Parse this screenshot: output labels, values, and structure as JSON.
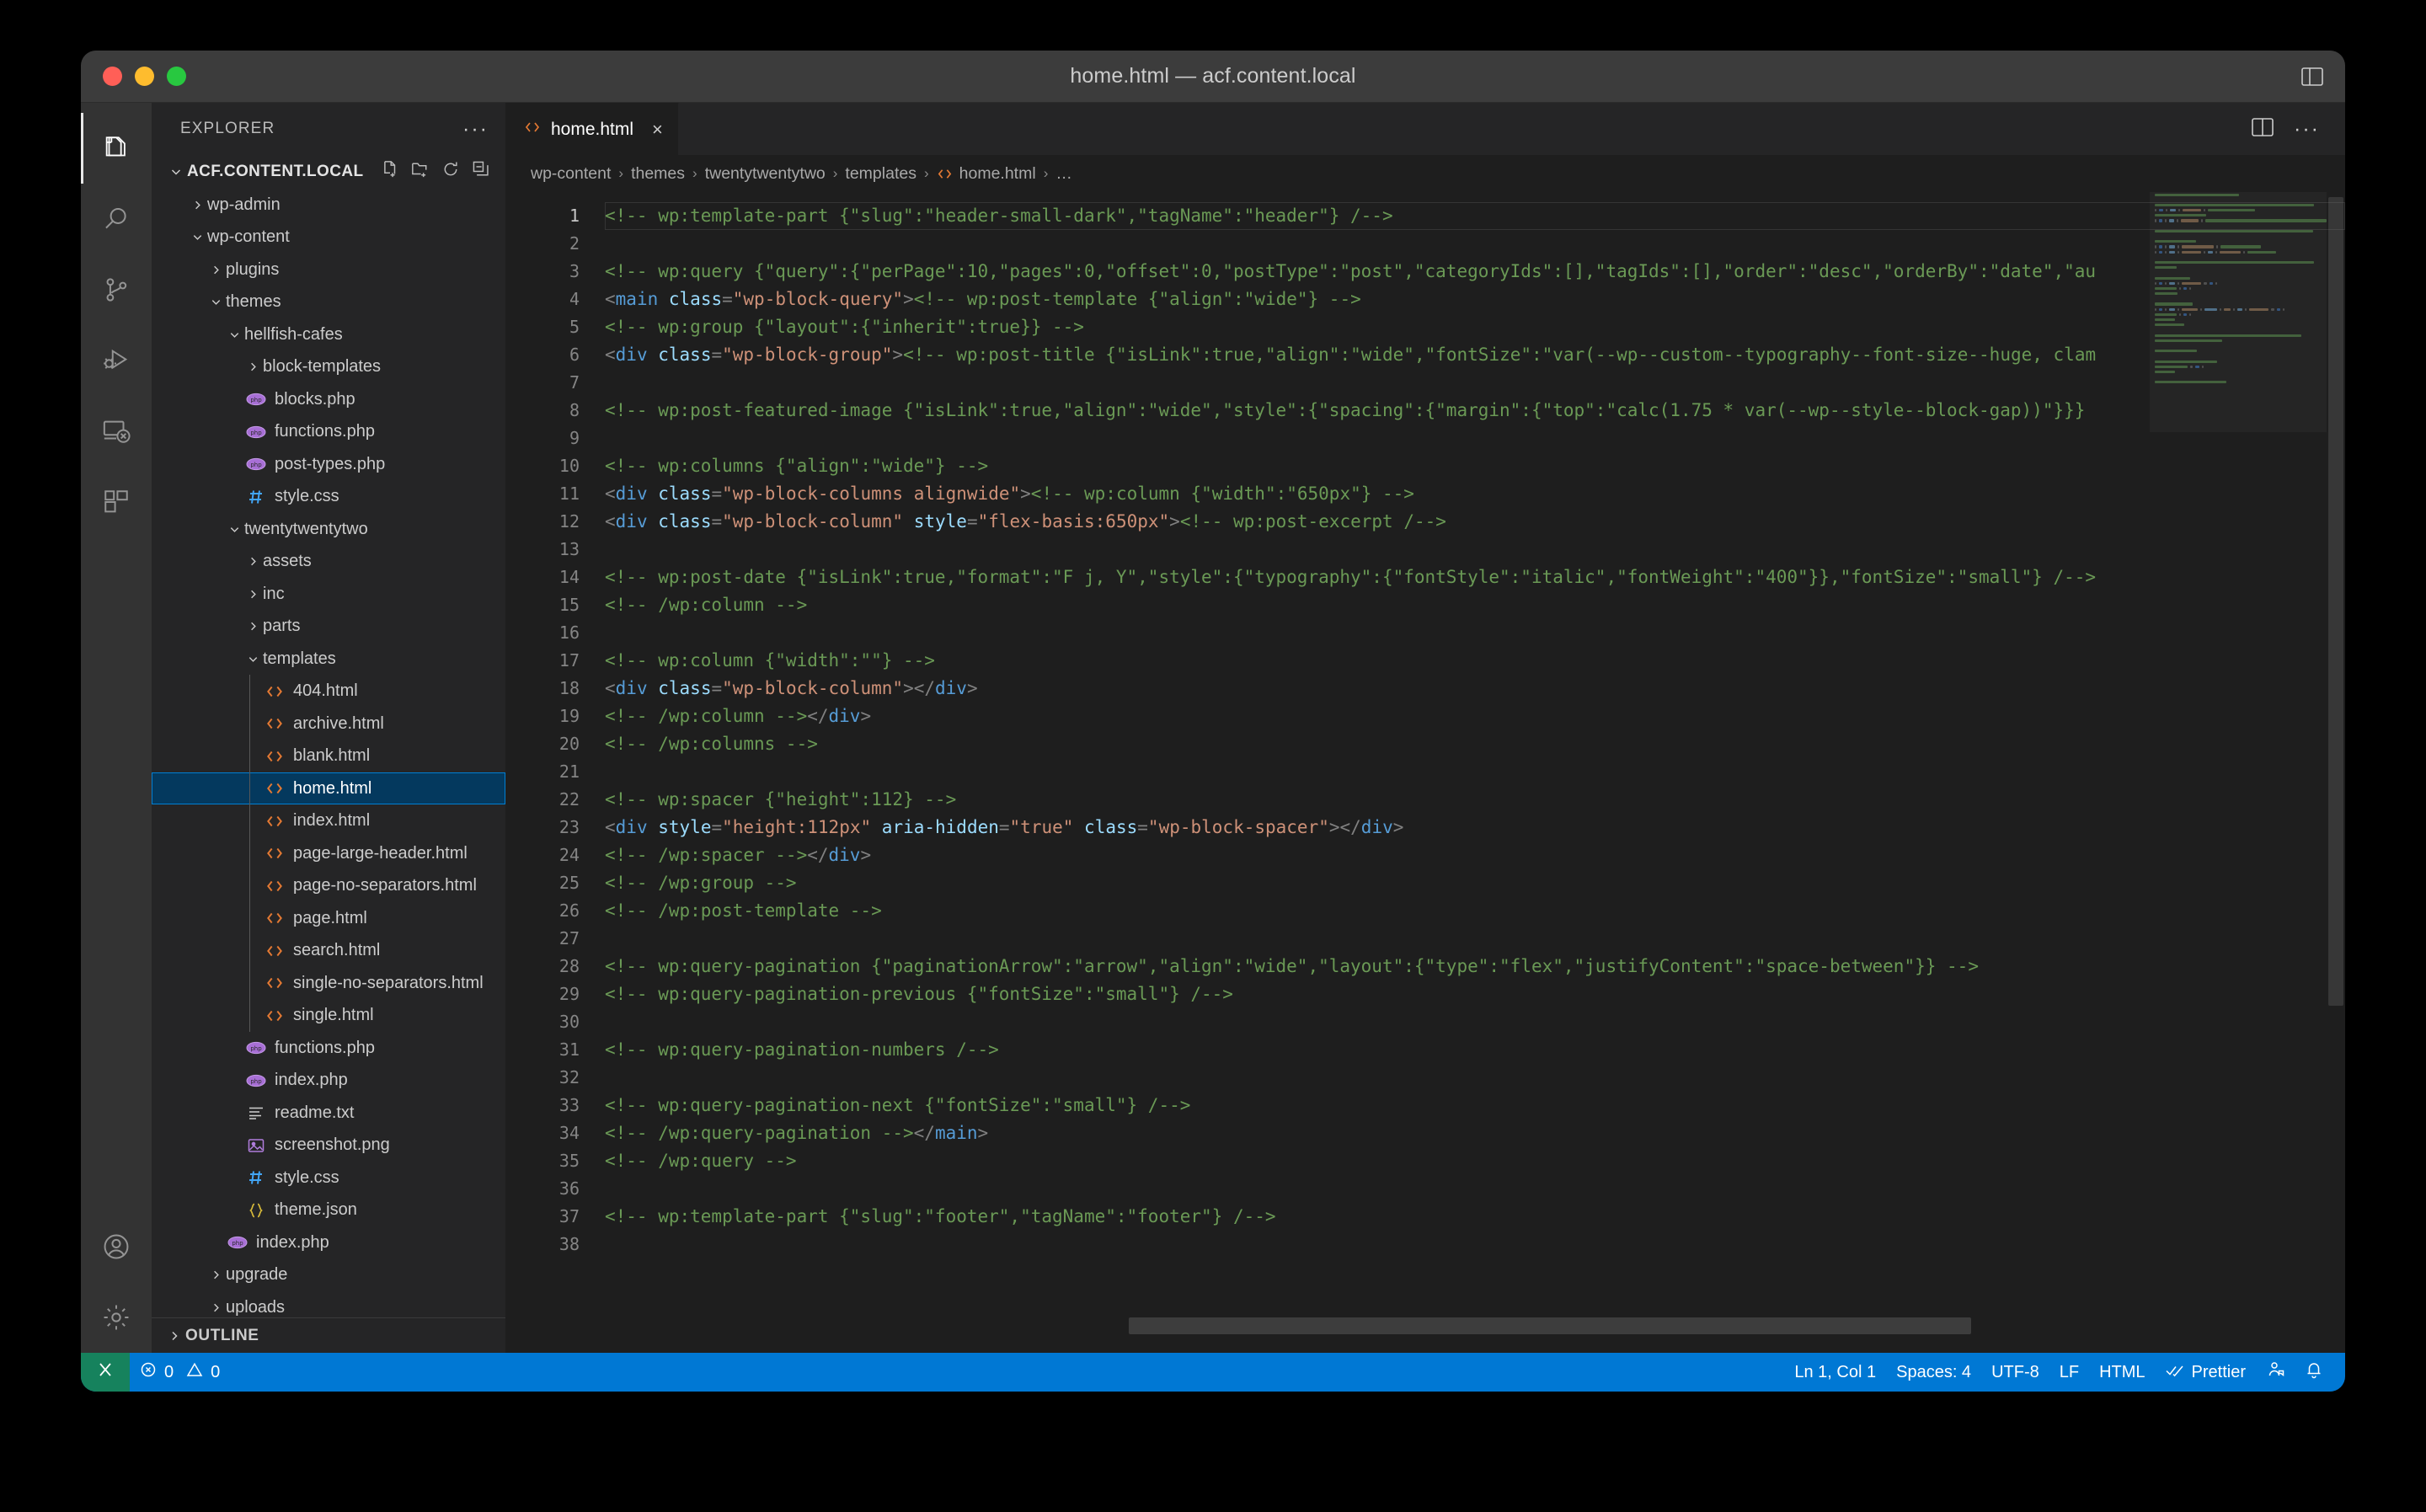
{
  "window": {
    "title": "home.html — acf.content.local",
    "traffic_lights": [
      "close-red",
      "minimize-yellow",
      "maximize-green"
    ],
    "layout_icon": "customize-layout-icon"
  },
  "activitybar": {
    "items": [
      {
        "name": "explorer",
        "icon": "files-icon",
        "active": true
      },
      {
        "name": "search",
        "icon": "search-icon",
        "active": false
      },
      {
        "name": "source-control",
        "icon": "source-control-icon",
        "active": false
      },
      {
        "name": "run-and-debug",
        "icon": "run-debug-icon",
        "active": false
      },
      {
        "name": "remote-explorer",
        "icon": "remote-explorer-icon",
        "active": false
      },
      {
        "name": "extensions",
        "icon": "extensions-icon",
        "active": false
      }
    ],
    "bottom_items": [
      {
        "name": "accounts",
        "icon": "account-icon"
      },
      {
        "name": "manage",
        "icon": "gear-icon"
      }
    ]
  },
  "sidebar": {
    "header_title": "EXPLORER",
    "more_actions_label": "···",
    "root_label": "ACF.CONTENT.LOCAL",
    "root_actions": [
      "new-file-icon",
      "new-folder-icon",
      "refresh-icon",
      "collapse-all-icon"
    ],
    "outline_label": "OUTLINE",
    "tree": [
      {
        "label": "wp-admin",
        "depth": 1,
        "type": "folder",
        "expanded": false
      },
      {
        "label": "wp-content",
        "depth": 1,
        "type": "folder",
        "expanded": true
      },
      {
        "label": "plugins",
        "depth": 2,
        "type": "folder",
        "expanded": false
      },
      {
        "label": "themes",
        "depth": 2,
        "type": "folder",
        "expanded": true
      },
      {
        "label": "hellfish-cafes",
        "depth": 3,
        "type": "folder",
        "expanded": true
      },
      {
        "label": "block-templates",
        "depth": 4,
        "type": "folder",
        "expanded": false
      },
      {
        "label": "blocks.php",
        "depth": 4,
        "type": "php"
      },
      {
        "label": "functions.php",
        "depth": 4,
        "type": "php"
      },
      {
        "label": "post-types.php",
        "depth": 4,
        "type": "php"
      },
      {
        "label": "style.css",
        "depth": 4,
        "type": "css"
      },
      {
        "label": "twentytwentytwo",
        "depth": 3,
        "type": "folder",
        "expanded": true
      },
      {
        "label": "assets",
        "depth": 4,
        "type": "folder",
        "expanded": false
      },
      {
        "label": "inc",
        "depth": 4,
        "type": "folder",
        "expanded": false
      },
      {
        "label": "parts",
        "depth": 4,
        "type": "folder",
        "expanded": false
      },
      {
        "label": "templates",
        "depth": 4,
        "type": "folder",
        "expanded": true
      },
      {
        "label": "404.html",
        "depth": 5,
        "type": "html"
      },
      {
        "label": "archive.html",
        "depth": 5,
        "type": "html"
      },
      {
        "label": "blank.html",
        "depth": 5,
        "type": "html"
      },
      {
        "label": "home.html",
        "depth": 5,
        "type": "html",
        "selected": true
      },
      {
        "label": "index.html",
        "depth": 5,
        "type": "html"
      },
      {
        "label": "page-large-header.html",
        "depth": 5,
        "type": "html"
      },
      {
        "label": "page-no-separators.html",
        "depth": 5,
        "type": "html"
      },
      {
        "label": "page.html",
        "depth": 5,
        "type": "html"
      },
      {
        "label": "search.html",
        "depth": 5,
        "type": "html"
      },
      {
        "label": "single-no-separators.html",
        "depth": 5,
        "type": "html"
      },
      {
        "label": "single.html",
        "depth": 5,
        "type": "html"
      },
      {
        "label": "functions.php",
        "depth": 4,
        "type": "php"
      },
      {
        "label": "index.php",
        "depth": 4,
        "type": "php"
      },
      {
        "label": "readme.txt",
        "depth": 4,
        "type": "txt"
      },
      {
        "label": "screenshot.png",
        "depth": 4,
        "type": "png"
      },
      {
        "label": "style.css",
        "depth": 4,
        "type": "css"
      },
      {
        "label": "theme.json",
        "depth": 4,
        "type": "json"
      },
      {
        "label": "index.php",
        "depth": 3,
        "type": "php"
      },
      {
        "label": "upgrade",
        "depth": 2,
        "type": "folder",
        "expanded": false
      },
      {
        "label": "uploads",
        "depth": 2,
        "type": "folder",
        "expanded": false
      }
    ]
  },
  "editor": {
    "tabs": [
      {
        "label": "home.html",
        "icon": "html-file-icon",
        "close_glyph": "×",
        "active": true
      }
    ],
    "actions": [
      "split-editor-icon",
      "more-actions-icon"
    ],
    "breadcrumbs": [
      {
        "label": "wp-content",
        "icon": null
      },
      {
        "label": "themes",
        "icon": null
      },
      {
        "label": "twentytwentytwo",
        "icon": null
      },
      {
        "label": "templates",
        "icon": null
      },
      {
        "label": "home.html",
        "icon": "html-file-icon"
      },
      {
        "label": "…",
        "icon": null
      }
    ],
    "breadcrumb_separator": "›",
    "total_lines": 38,
    "current_line": 1,
    "lines": [
      {
        "n": 1,
        "tokens": [
          {
            "t": "<!-- wp:template-part {\"slug\":\"header-small-dark\",\"tagName\":\"header\"} /-->",
            "c": "cm"
          }
        ]
      },
      {
        "n": 2,
        "tokens": []
      },
      {
        "n": 3,
        "tokens": [
          {
            "t": "<!-- wp:query {\"query\":{\"perPage\":10,\"pages\":0,\"offset\":0,\"postType\":\"post\",\"categoryIds\":[],\"tagIds\":[],\"order\":\"desc\",\"orderBy\":\"date\",\"au",
            "c": "cm"
          }
        ]
      },
      {
        "n": 4,
        "tokens": [
          {
            "t": "<",
            "c": "pn"
          },
          {
            "t": "main",
            "c": "tg"
          },
          {
            "t": " ",
            "c": "pn"
          },
          {
            "t": "class",
            "c": "at"
          },
          {
            "t": "=",
            "c": "pn"
          },
          {
            "t": "\"wp-block-query\"",
            "c": "st"
          },
          {
            "t": ">",
            "c": "pn"
          },
          {
            "t": "<!-- wp:post-template {\"align\":\"wide\"} -->",
            "c": "cm"
          }
        ]
      },
      {
        "n": 5,
        "tokens": [
          {
            "t": "<!-- wp:group {\"layout\":{\"inherit\":true}} -->",
            "c": "cm"
          }
        ]
      },
      {
        "n": 6,
        "tokens": [
          {
            "t": "<",
            "c": "pn"
          },
          {
            "t": "div",
            "c": "tg"
          },
          {
            "t": " ",
            "c": "pn"
          },
          {
            "t": "class",
            "c": "at"
          },
          {
            "t": "=",
            "c": "pn"
          },
          {
            "t": "\"wp-block-group\"",
            "c": "st"
          },
          {
            "t": ">",
            "c": "pn"
          },
          {
            "t": "<!-- wp:post-title {\"isLink\":true,\"align\":\"wide\",\"fontSize\":\"var(--wp--custom--typography--font-size--huge, clam",
            "c": "cm"
          }
        ]
      },
      {
        "n": 7,
        "tokens": []
      },
      {
        "n": 8,
        "tokens": [
          {
            "t": "<!-- wp:post-featured-image {\"isLink\":true,\"align\":\"wide\",\"style\":{\"spacing\":{\"margin\":{\"top\":\"calc(1.75 * var(--wp--style--block-gap))\"}}}",
            "c": "cm"
          }
        ]
      },
      {
        "n": 9,
        "tokens": []
      },
      {
        "n": 10,
        "tokens": [
          {
            "t": "<!-- wp:columns {\"align\":\"wide\"} -->",
            "c": "cm"
          }
        ]
      },
      {
        "n": 11,
        "tokens": [
          {
            "t": "<",
            "c": "pn"
          },
          {
            "t": "div",
            "c": "tg"
          },
          {
            "t": " ",
            "c": "pn"
          },
          {
            "t": "class",
            "c": "at"
          },
          {
            "t": "=",
            "c": "pn"
          },
          {
            "t": "\"wp-block-columns alignwide\"",
            "c": "st"
          },
          {
            "t": ">",
            "c": "pn"
          },
          {
            "t": "<!-- wp:column {\"width\":\"650px\"} -->",
            "c": "cm"
          }
        ]
      },
      {
        "n": 12,
        "tokens": [
          {
            "t": "<",
            "c": "pn"
          },
          {
            "t": "div",
            "c": "tg"
          },
          {
            "t": " ",
            "c": "pn"
          },
          {
            "t": "class",
            "c": "at"
          },
          {
            "t": "=",
            "c": "pn"
          },
          {
            "t": "\"wp-block-column\"",
            "c": "st"
          },
          {
            "t": " ",
            "c": "pn"
          },
          {
            "t": "style",
            "c": "at"
          },
          {
            "t": "=",
            "c": "pn"
          },
          {
            "t": "\"flex-basis:650px\"",
            "c": "st"
          },
          {
            "t": ">",
            "c": "pn"
          },
          {
            "t": "<!-- wp:post-excerpt /-->",
            "c": "cm"
          }
        ]
      },
      {
        "n": 13,
        "tokens": []
      },
      {
        "n": 14,
        "tokens": [
          {
            "t": "<!-- wp:post-date {\"isLink\":true,\"format\":\"F j, Y\",\"style\":{\"typography\":{\"fontStyle\":\"italic\",\"fontWeight\":\"400\"}},\"fontSize\":\"small\"} /-->",
            "c": "cm"
          }
        ]
      },
      {
        "n": 15,
        "tokens": [
          {
            "t": "<!-- /wp:column -->",
            "c": "cm"
          }
        ]
      },
      {
        "n": 16,
        "tokens": []
      },
      {
        "n": 17,
        "tokens": [
          {
            "t": "<!-- wp:column {\"width\":\"\"} -->",
            "c": "cm"
          }
        ]
      },
      {
        "n": 18,
        "tokens": [
          {
            "t": "<",
            "c": "pn"
          },
          {
            "t": "div",
            "c": "tg"
          },
          {
            "t": " ",
            "c": "pn"
          },
          {
            "t": "class",
            "c": "at"
          },
          {
            "t": "=",
            "c": "pn"
          },
          {
            "t": "\"wp-block-column\"",
            "c": "st"
          },
          {
            "t": "></",
            "c": "pn"
          },
          {
            "t": "div",
            "c": "tg"
          },
          {
            "t": ">",
            "c": "pn"
          }
        ]
      },
      {
        "n": 19,
        "tokens": [
          {
            "t": "<!-- /wp:column -->",
            "c": "cm"
          },
          {
            "t": "</",
            "c": "pn"
          },
          {
            "t": "div",
            "c": "tg"
          },
          {
            "t": ">",
            "c": "pn"
          }
        ]
      },
      {
        "n": 20,
        "tokens": [
          {
            "t": "<!-- /wp:columns -->",
            "c": "cm"
          }
        ]
      },
      {
        "n": 21,
        "tokens": []
      },
      {
        "n": 22,
        "tokens": [
          {
            "t": "<!-- wp:spacer {\"height\":112} -->",
            "c": "cm"
          }
        ]
      },
      {
        "n": 23,
        "tokens": [
          {
            "t": "<",
            "c": "pn"
          },
          {
            "t": "div",
            "c": "tg"
          },
          {
            "t": " ",
            "c": "pn"
          },
          {
            "t": "style",
            "c": "at"
          },
          {
            "t": "=",
            "c": "pn"
          },
          {
            "t": "\"height:112px\"",
            "c": "st"
          },
          {
            "t": " ",
            "c": "pn"
          },
          {
            "t": "aria-hidden",
            "c": "at"
          },
          {
            "t": "=",
            "c": "pn"
          },
          {
            "t": "\"true\"",
            "c": "st"
          },
          {
            "t": " ",
            "c": "pn"
          },
          {
            "t": "class",
            "c": "at"
          },
          {
            "t": "=",
            "c": "pn"
          },
          {
            "t": "\"wp-block-spacer\"",
            "c": "st"
          },
          {
            "t": "></",
            "c": "pn"
          },
          {
            "t": "div",
            "c": "tg"
          },
          {
            "t": ">",
            "c": "pn"
          }
        ]
      },
      {
        "n": 24,
        "tokens": [
          {
            "t": "<!-- /wp:spacer -->",
            "c": "cm"
          },
          {
            "t": "</",
            "c": "pn"
          },
          {
            "t": "div",
            "c": "tg"
          },
          {
            "t": ">",
            "c": "pn"
          }
        ]
      },
      {
        "n": 25,
        "tokens": [
          {
            "t": "<!-- /wp:group -->",
            "c": "cm"
          }
        ]
      },
      {
        "n": 26,
        "tokens": [
          {
            "t": "<!-- /wp:post-template -->",
            "c": "cm"
          }
        ]
      },
      {
        "n": 27,
        "tokens": []
      },
      {
        "n": 28,
        "tokens": [
          {
            "t": "<!-- wp:query-pagination {\"paginationArrow\":\"arrow\",\"align\":\"wide\",\"layout\":{\"type\":\"flex\",\"justifyContent\":\"space-between\"}} -->",
            "c": "cm"
          }
        ]
      },
      {
        "n": 29,
        "tokens": [
          {
            "t": "<!-- wp:query-pagination-previous {\"fontSize\":\"small\"} /-->",
            "c": "cm"
          }
        ]
      },
      {
        "n": 30,
        "tokens": []
      },
      {
        "n": 31,
        "tokens": [
          {
            "t": "<!-- wp:query-pagination-numbers /-->",
            "c": "cm"
          }
        ]
      },
      {
        "n": 32,
        "tokens": []
      },
      {
        "n": 33,
        "tokens": [
          {
            "t": "<!-- wp:query-pagination-next {\"fontSize\":\"small\"} /-->",
            "c": "cm"
          }
        ]
      },
      {
        "n": 34,
        "tokens": [
          {
            "t": "<!-- /wp:query-pagination -->",
            "c": "cm"
          },
          {
            "t": "</",
            "c": "pn"
          },
          {
            "t": "main",
            "c": "tg"
          },
          {
            "t": ">",
            "c": "pn"
          }
        ]
      },
      {
        "n": 35,
        "tokens": [
          {
            "t": "<!-- /wp:query -->",
            "c": "cm"
          }
        ]
      },
      {
        "n": 36,
        "tokens": []
      },
      {
        "n": 37,
        "tokens": [
          {
            "t": "<!-- wp:template-part {\"slug\":\"footer\",\"tagName\":\"footer\"} /-->",
            "c": "cm"
          }
        ]
      },
      {
        "n": 38,
        "tokens": []
      }
    ]
  },
  "statusbar": {
    "remote_icon": "remote-window-icon",
    "errors_icon": "error-icon",
    "errors_count": "0",
    "warnings_icon": "warning-icon",
    "warnings_count": "0",
    "cursor_position": "Ln 1, Col 1",
    "indentation": "Spaces: 4",
    "encoding": "UTF-8",
    "eol": "LF",
    "language_mode": "HTML",
    "formatter_icon": "checkmarks-icon",
    "formatter": "Prettier",
    "feedback_icon": "feedback-icon",
    "notifications_icon": "bell-icon",
    "background": "#0078d4",
    "remote_background": "#16825d"
  },
  "colors": {
    "accent": "#0078d4",
    "selection": "#04395e",
    "selection_border": "#007fd4",
    "comment": "#6a9955",
    "tag": "#569cd6",
    "attribute": "#9cdcfe",
    "string": "#ce9178",
    "editor_bg": "#1e1e1e",
    "sidebar_bg": "#252526",
    "activitybar_bg": "#333333",
    "titlebar_bg": "#3c3c3c"
  }
}
